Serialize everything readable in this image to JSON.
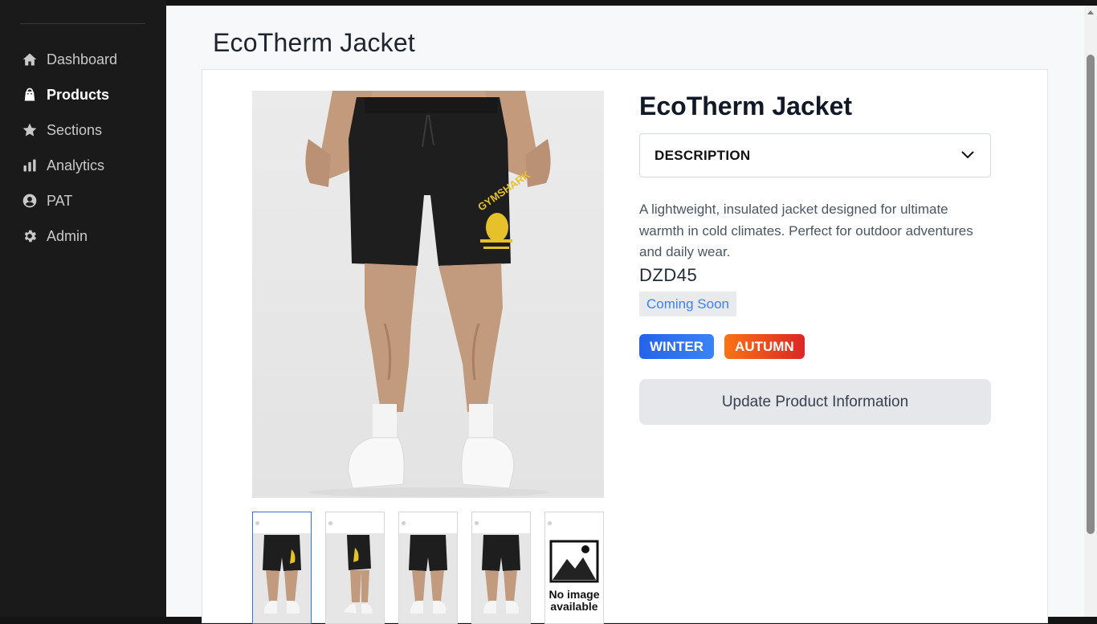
{
  "sidebar": {
    "items": [
      {
        "label": "Dashboard",
        "icon": "home-icon",
        "active": false
      },
      {
        "label": "Products",
        "icon": "shopping-bag-icon",
        "active": true
      },
      {
        "label": "Sections",
        "icon": "star-icon",
        "active": false
      },
      {
        "label": "Analytics",
        "icon": "bar-chart-icon",
        "active": false
      },
      {
        "label": "PAT",
        "icon": "user-circle-icon",
        "active": false
      },
      {
        "label": "Admin",
        "icon": "gear-icon",
        "active": false
      }
    ]
  },
  "page": {
    "title": "EcoTherm Jacket"
  },
  "product": {
    "name": "EcoTherm Jacket",
    "accordion_label": "DESCRIPTION",
    "description": "A lightweight, insulated jacket designed for ultimate warmth in cold climates. Perfect for outdoor adventures and daily wear.",
    "price": "DZD45",
    "status": "Coming Soon",
    "tags": [
      "WINTER",
      "AUTUMN"
    ],
    "update_button": "Update Product Information",
    "thumbnails": [
      "thumbnail-front",
      "thumbnail-side",
      "thumbnail-front-2",
      "thumbnail-back",
      "thumbnail-placeholder"
    ],
    "no_image_text": "No image available"
  },
  "colors": {
    "sidebar_bg": "#1a1a1a",
    "accent_blue": "#3b82f6",
    "tag_winter": "#2563eb",
    "tag_autumn": "#ea580c"
  }
}
